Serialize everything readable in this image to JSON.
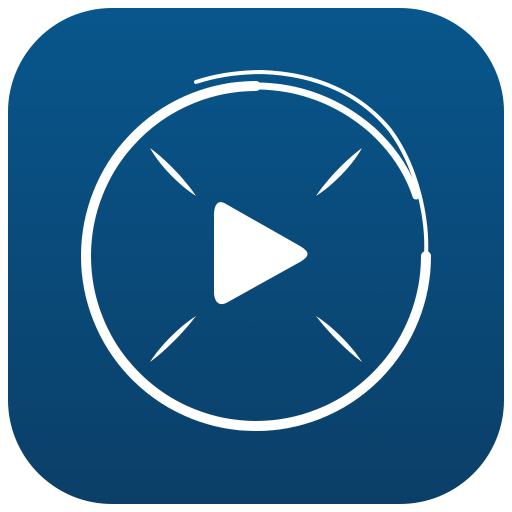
{
  "app_icon": {
    "name": "video-player-app-icon",
    "glyph": "play-icon",
    "colors": {
      "background_top": "#08568C",
      "background_bottom": "#0B3F68",
      "foreground": "#FFFFFF"
    }
  }
}
